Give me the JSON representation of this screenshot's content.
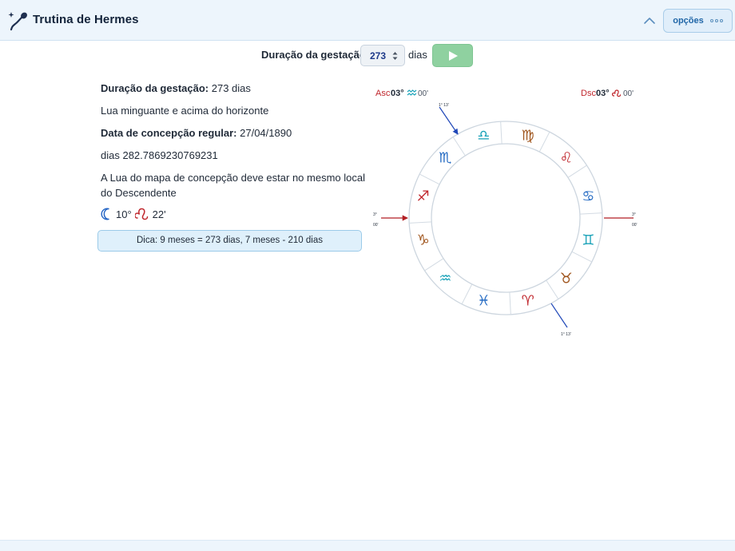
{
  "header": {
    "title": "Trutina de Hermes",
    "options_label": "opções"
  },
  "controls": {
    "duration_label": "Duração da gestação",
    "duration_value": "273",
    "days_label": "dias"
  },
  "info": {
    "duration_label": "Duração da gestação:",
    "duration_value": "273 dias",
    "moon_phase": "Lua minguante e acima do horizonte",
    "conception_label": "Data de concepção regular:",
    "conception_value": "27/04/1890",
    "days_line": "dias 282.7869230769231",
    "rule_line1": "A Lua do mapa de concepção deve estar no mesmo local",
    "rule_line2": "do Descendente",
    "moon_degree": "10°",
    "moon_minute": "22'"
  },
  "tip": "Dica: 9 meses = 273 dias, 7 meses - 210 dias",
  "chart": {
    "asc": {
      "label": "Asc",
      "degree": "03°",
      "minute": "00'"
    },
    "dsc": {
      "label": "Dsc",
      "degree": "03°",
      "minute": "00'"
    },
    "mc": "1° 13'",
    "ic": "1° 13'",
    "left_axis": {
      "degree": "3°",
      "minute": "00'"
    },
    "right_axis": {
      "degree": "3°",
      "minute": "00'"
    },
    "signs": [
      "libra",
      "virgo",
      "leo",
      "cancer",
      "gemini",
      "taurus",
      "aries",
      "pisces",
      "aquarius",
      "capricorn",
      "sagittarius",
      "scorpio"
    ],
    "colors": {
      "fire": "#c0272d",
      "earth": "#a0561e",
      "air": "#1aa2b8",
      "water": "#2269c2"
    }
  }
}
